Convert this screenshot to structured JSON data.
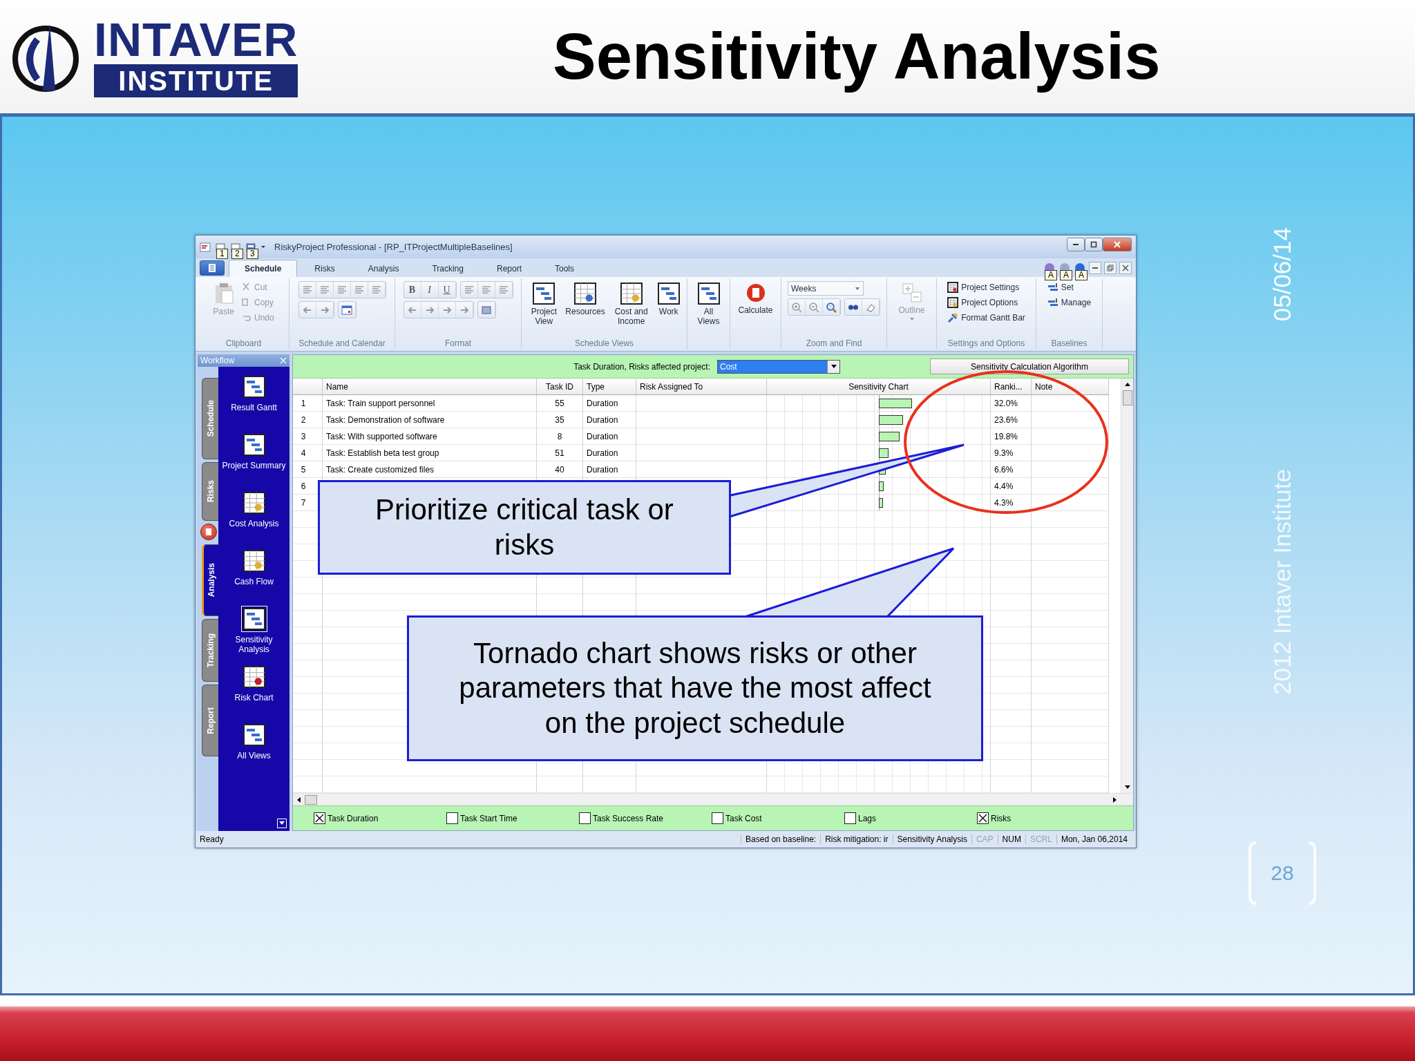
{
  "slide": {
    "logo": {
      "word": "INTAVER",
      "subword": "INSTITUTE"
    },
    "title": "Sensitivity Analysis",
    "date": "05/06/14",
    "footer": "2012 Intaver Institute",
    "page_number": "28"
  },
  "app": {
    "title": "RiskyProject Professional - [RP_ITProjectMultipleBaselines]",
    "quick_access_keytips": [
      "1",
      "2",
      "3"
    ],
    "tabs": [
      {
        "label": "Schedule",
        "selected": true
      },
      {
        "label": "Risks",
        "selected": false
      },
      {
        "label": "Analysis",
        "selected": false
      },
      {
        "label": "Tracking",
        "selected": false
      },
      {
        "label": "Report",
        "selected": false
      },
      {
        "label": "Tools",
        "selected": false
      }
    ],
    "help_keytips": [
      "A",
      "A",
      "A"
    ],
    "ribbon": {
      "clipboard": {
        "label": "Clipboard",
        "paste": {
          "label": "Paste",
          "disabled": true
        },
        "items": [
          {
            "label": "Cut",
            "disabled": true
          },
          {
            "label": "Copy",
            "disabled": true
          },
          {
            "label": "Undo",
            "disabled": true
          }
        ]
      },
      "schedule_calendar": {
        "label": "Schedule and Calendar"
      },
      "format": {
        "label": "Format",
        "styles": [
          "B",
          "I",
          "U"
        ]
      },
      "schedule_views": {
        "label": "Schedule Views",
        "buttons": [
          "Project View",
          "Resources",
          "Cost and Income",
          "Work"
        ]
      },
      "all_views": "All Views",
      "calculate": "Calculate",
      "zoom": {
        "label": "Zoom and Find",
        "scale": "Weeks"
      },
      "outline": {
        "label": "Outline",
        "disabled": true
      },
      "settings": {
        "label": "Settings and Options",
        "items": [
          "Project Settings",
          "Project Options",
          "Format Gantt Bar"
        ]
      },
      "baselines": {
        "label": "Baselines",
        "items": [
          "Set",
          "Manage"
        ]
      }
    },
    "workflow": {
      "title": "Workflow",
      "tabs": [
        {
          "label": "Schedule",
          "selected": false
        },
        {
          "label": "Risks",
          "selected": false
        },
        {
          "label": "Analysis",
          "selected": true
        },
        {
          "label": "Tracking",
          "selected": false
        },
        {
          "label": "Report",
          "selected": false
        }
      ],
      "items": [
        {
          "label": "Result Gantt",
          "selected": false
        },
        {
          "label": "Project Summary",
          "selected": false
        },
        {
          "label": "Cost Analysis",
          "selected": false
        },
        {
          "label": "Cash Flow",
          "selected": false
        },
        {
          "label": "Sensitivity Analysis",
          "selected": true
        },
        {
          "label": "Risk Chart",
          "selected": false
        },
        {
          "label": "All Views",
          "selected": false
        }
      ]
    },
    "sensitivity": {
      "caption": "Task Duration, Risks affected project:",
      "target": "Cost",
      "algorithm_button": "Sensitivity Calculation Algorithm",
      "columns": [
        "Name",
        "Task ID",
        "Type",
        "Risk Assigned To",
        "Sensitivity Chart",
        "Ranki...",
        "Note"
      ],
      "rows": [
        {
          "number": "1",
          "name": "Task: Train support personnel",
          "task_id": "55",
          "type": "Duration",
          "ranking": "32.0%"
        },
        {
          "number": "2",
          "name": "Task: Demonstration of software",
          "task_id": "35",
          "type": "Duration",
          "ranking": "23.6%"
        },
        {
          "number": "3",
          "name": "Task: With supported software",
          "task_id": "8",
          "type": "Duration",
          "ranking": "19.8%"
        },
        {
          "number": "4",
          "name": "Task: Establish beta test group",
          "task_id": "51",
          "type": "Duration",
          "ranking": "9.3%"
        },
        {
          "number": "5",
          "name": "Task: Create customized files",
          "task_id": "40",
          "type": "Duration",
          "ranking": "6.6%"
        },
        {
          "number": "6",
          "ranking": "4.4%"
        },
        {
          "number": "7",
          "ranking": "4.3%"
        }
      ],
      "filters": [
        {
          "label": "Task Duration",
          "checked": true
        },
        {
          "label": "Task Start Time",
          "checked": false
        },
        {
          "label": "Task Success Rate",
          "checked": false
        },
        {
          "label": "Task Cost",
          "checked": false
        },
        {
          "label": "Lags",
          "checked": false
        },
        {
          "label": "Risks",
          "checked": true
        }
      ]
    },
    "status_bar": {
      "ready": "Ready",
      "fields": [
        {
          "text": "Based on baseline:",
          "disabled": false
        },
        {
          "text": "Risk mitigation: ir",
          "disabled": false
        },
        {
          "text": "Sensitivity Analysis",
          "disabled": false
        },
        {
          "text": "CAP",
          "disabled": true
        },
        {
          "text": "NUM",
          "disabled": false
        },
        {
          "text": "SCRL",
          "disabled": true
        },
        {
          "text": "Mon, Jan 06,2014",
          "disabled": false
        }
      ]
    }
  },
  "callouts": [
    {
      "text": "Prioritize critical task or risks"
    },
    {
      "text": "Tornado chart shows risks or other parameters that have the most affect on the project schedule"
    }
  ]
}
